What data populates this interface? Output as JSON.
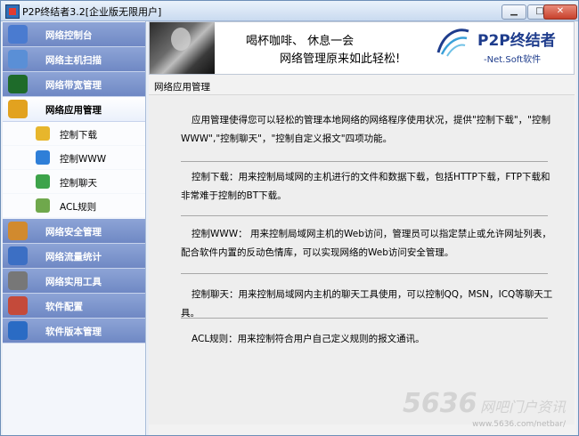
{
  "window": {
    "title": "P2P终结者3.2[企业版无限用户]",
    "controls": {
      "minimize": "▁",
      "maximize": "□",
      "close": "✕"
    }
  },
  "sidebar": {
    "items": [
      {
        "label": "网络控制台",
        "icon": "globe-icon",
        "color": "#4a7bd0"
      },
      {
        "label": "网络主机扫描",
        "icon": "computer-icon",
        "color": "#5a8fd6"
      },
      {
        "label": "网络带宽管理",
        "icon": "bandwidth-icon",
        "color": "#1e6b2a"
      },
      {
        "label": "网络应用管理",
        "icon": "windows-icon",
        "color": "#e2a21f",
        "active": true
      }
    ],
    "subitems": [
      {
        "label": "控制下载",
        "icon": "download-icon",
        "color": "#e7b62c"
      },
      {
        "label": "控制WWW",
        "icon": "ie-icon",
        "color": "#2f7fd8"
      },
      {
        "label": "控制聊天",
        "icon": "chat-icon",
        "color": "#3da34a"
      },
      {
        "label": "ACL规则",
        "icon": "rules-icon",
        "color": "#6fa84c"
      }
    ],
    "bottom_items": [
      {
        "label": "网络安全管理",
        "icon": "security-icon",
        "color": "#d18a2e"
      },
      {
        "label": "网络流量统计",
        "icon": "stats-icon",
        "color": "#3c6fc4"
      },
      {
        "label": "网络实用工具",
        "icon": "tools-icon",
        "color": "#777777"
      },
      {
        "label": "软件配置",
        "icon": "config-icon",
        "color": "#c44a3a"
      },
      {
        "label": "软件版本管理",
        "icon": "help-icon",
        "color": "#2a6bc4"
      }
    ]
  },
  "banner": {
    "slogan_line1": "喝杯咖啡、  休息一会",
    "slogan_line2": "网络管理原来如此轻松!",
    "brand_name": "P2P终结者",
    "brand_sub": "-Net.Soft软件"
  },
  "panel": {
    "title": "网络应用管理",
    "paragraphs": [
      "应用管理使得您可以轻松的管理本地网络的网络程序使用状况，提供\"控制下载\"，\"控制WWW\",\"控制聊天\"，\"控制自定义报文\"四项功能。",
      "控制下载：用来控制局域网的主机进行的文件和数据下载，包括HTTP下载，FTP下载和非常难于控制的BT下载。",
      "控制WWW： 用来控制局域网主机的Web访问，管理员可以指定禁止或允许网址列表，配合软件内置的反动色情库，可以实现网络的Web访问安全管理。",
      "控制聊天：用来控制局域网内主机的聊天工具使用，可以控制QQ，MSN，ICQ等聊天工具。",
      "ACL规则：用来控制符合用户自己定义规则的报文通讯。"
    ]
  },
  "watermark": {
    "number": "5636",
    "text": "网吧门户资讯",
    "url": "www.5636.com/netbar/"
  }
}
